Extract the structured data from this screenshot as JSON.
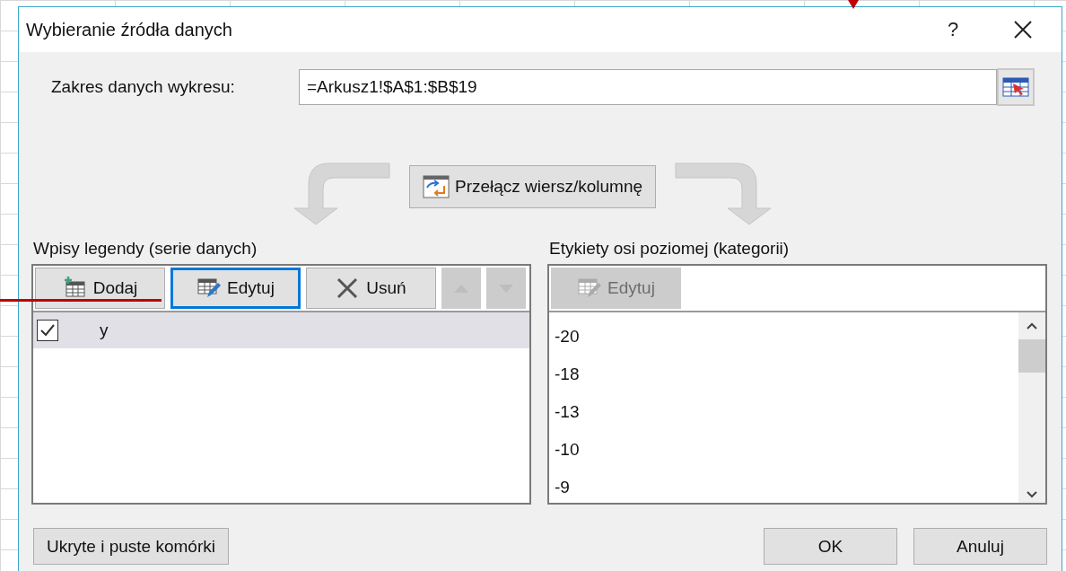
{
  "window": {
    "title": "Wybieranie źródła danych",
    "help": "?"
  },
  "chart_range": {
    "label": "Zakres danych wykresu:",
    "value": "=Arkusz1!$A$1:$B$19"
  },
  "switch_button": {
    "label": "Przełącz wiersz/kolumnę"
  },
  "legend": {
    "label": "Wpisy legendy (serie danych)",
    "buttons": [
      {
        "kind": "add",
        "label": "Dodaj",
        "focused": false,
        "disabled": false
      },
      {
        "kind": "edit",
        "label": "Edytuj",
        "focused": true,
        "disabled": false
      },
      {
        "kind": "remove",
        "label": "Usuń",
        "focused": false,
        "disabled": false
      },
      {
        "kind": "up",
        "focused": false,
        "disabled": true
      },
      {
        "kind": "down",
        "focused": false,
        "disabled": true
      }
    ],
    "series": [
      {
        "name": "y",
        "checked": true,
        "selected": true
      }
    ]
  },
  "axis": {
    "label": "Etykiety osi poziomej (kategorii)",
    "edit_button": {
      "label": "Edytuj",
      "disabled": true
    },
    "items": [
      "-20",
      "-18",
      "-13",
      "-10",
      "-9"
    ]
  },
  "footer": {
    "hidden_cells_button": "Ukryte i puste komórki",
    "ok_button": "OK",
    "cancel_button": "Anuluj"
  }
}
